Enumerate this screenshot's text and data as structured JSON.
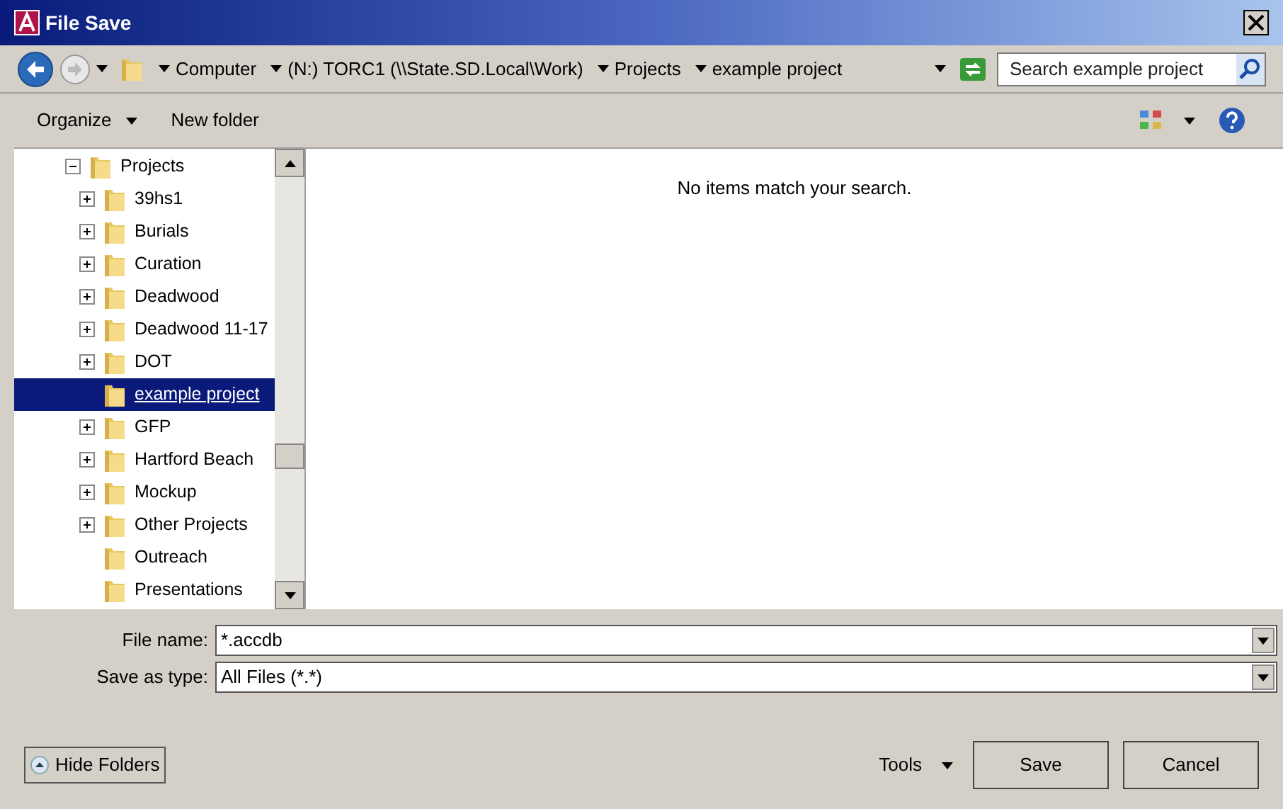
{
  "window": {
    "title": "File Save"
  },
  "address_bar": {
    "crumbs": [
      "Computer",
      "(N:) TORC1 (\\\\State.SD.Local\\Work)",
      "Projects",
      "example project"
    ],
    "search": {
      "placeholder": "Search example project"
    }
  },
  "toolbar": {
    "organize": "Organize",
    "new_folder": "New folder"
  },
  "tree": [
    {
      "label": "Projects",
      "expanded": true,
      "selected": false,
      "children": [
        {
          "label": "39hs1",
          "expandable": true,
          "selected": false
        },
        {
          "label": "Burials",
          "expandable": true,
          "selected": false
        },
        {
          "label": "Curation",
          "expandable": true,
          "selected": false
        },
        {
          "label": "Deadwood",
          "expandable": true,
          "selected": false
        },
        {
          "label": "Deadwood 11-17",
          "expandable": true,
          "selected": false
        },
        {
          "label": "DOT",
          "expandable": true,
          "selected": false
        },
        {
          "label": "example project",
          "expandable": false,
          "selected": true
        },
        {
          "label": "GFP",
          "expandable": true,
          "selected": false
        },
        {
          "label": "Hartford Beach",
          "expandable": true,
          "selected": false
        },
        {
          "label": "Mockup",
          "expandable": true,
          "selected": false
        },
        {
          "label": "Other Projects",
          "expandable": true,
          "selected": false
        },
        {
          "label": "Outreach",
          "expandable": false,
          "selected": false
        },
        {
          "label": "Presentations",
          "expandable": false,
          "selected": false
        }
      ]
    }
  ],
  "content": {
    "message": "No items match your search."
  },
  "fields": [
    {
      "label": "File name:",
      "value": "*.accdb"
    },
    {
      "label": "Save as type:",
      "value": "All Files (*.*)"
    }
  ],
  "footer": {
    "hide_folders": "Hide Folders",
    "tools": "Tools",
    "buttons": [
      "Save",
      "Cancel"
    ]
  }
}
